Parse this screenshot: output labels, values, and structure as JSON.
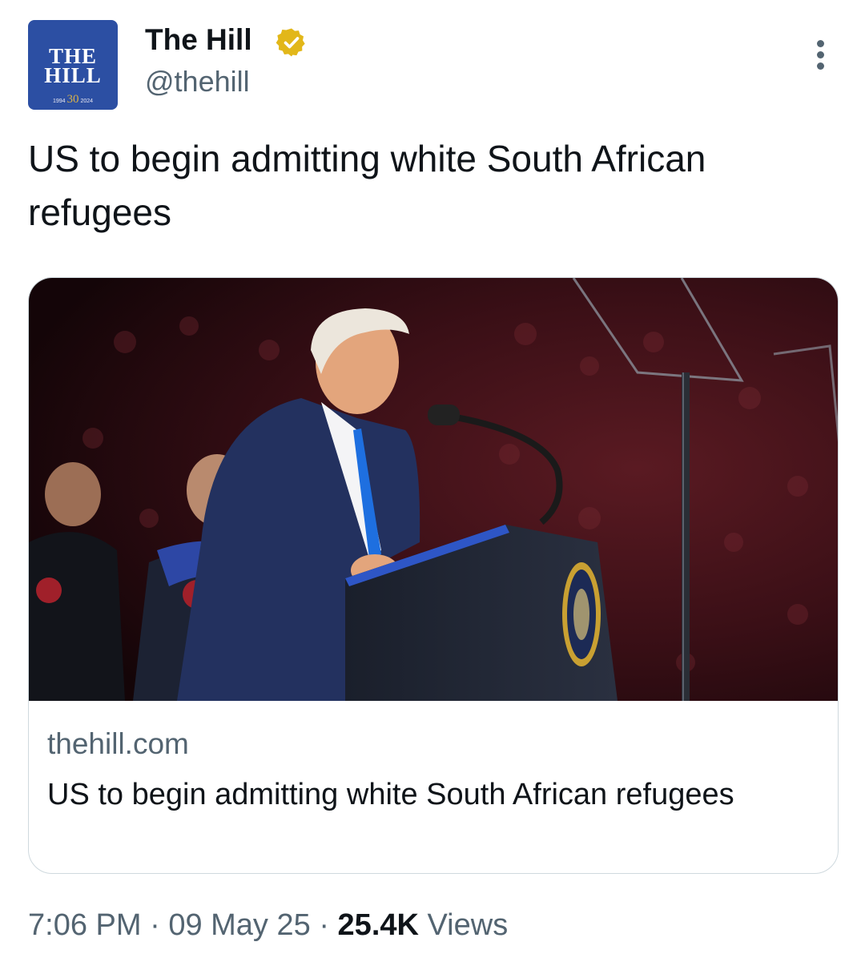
{
  "account": {
    "avatar": {
      "logo_line1": "THE",
      "logo_line2": "HILL",
      "logo_year_start": "1994",
      "logo_anniversary": "30",
      "logo_year_end": "2024",
      "bg_color": "#2c4fa3"
    },
    "display_name": "The Hill",
    "handle": "@thehill",
    "verified": true,
    "verified_color": "#e2b719"
  },
  "tweet": {
    "text": "US to begin admitting white South African refugees"
  },
  "card": {
    "image_icon": "news-photo",
    "domain": "thehill.com",
    "title": "US to begin admitting white South African refugees"
  },
  "meta": {
    "time": "7:06 PM",
    "separator": "·",
    "date": "09 May 25",
    "views_count": "25.4K",
    "views_label": "Views"
  }
}
